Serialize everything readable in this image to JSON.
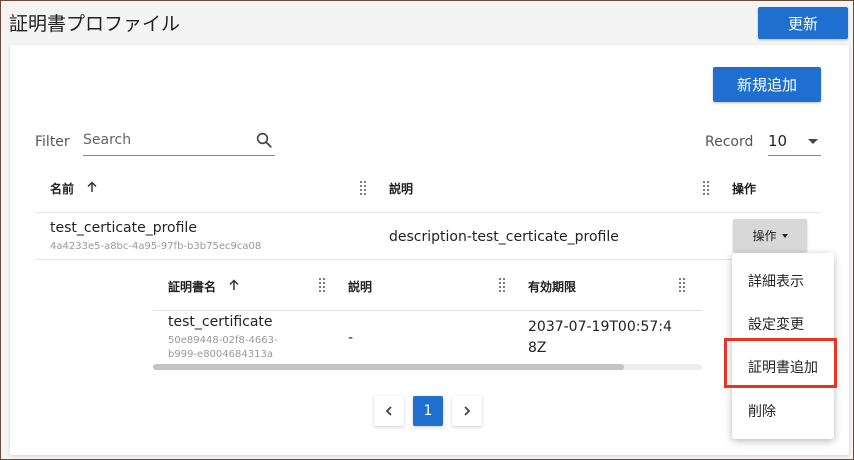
{
  "header": {
    "title": "証明書プロファイル",
    "refresh_label": "更新"
  },
  "toolbar": {
    "add_label": "新規追加",
    "filter_label": "Filter",
    "search_placeholder": "Search",
    "record_label": "Record",
    "record_value": "10"
  },
  "table": {
    "columns": [
      "名前",
      "説明",
      "操作"
    ],
    "rows": [
      {
        "name": "test_certicate_profile",
        "id": "4a4233e5-a8bc-4a95-97fb-b3b75ec9ca08",
        "description": "description-test_certicate_profile",
        "action_label": "操作"
      }
    ]
  },
  "subtable": {
    "columns": [
      "証明書名",
      "説明",
      "有効期限"
    ],
    "rows": [
      {
        "name": "test_certificate",
        "id_line1": "50e89448-02f8-4663-",
        "id_line2": "b999-e8004684313a",
        "description": "-",
        "expiry_line1": "2037-07-19T00:57:4",
        "expiry_line2": "8Z"
      }
    ]
  },
  "pagination": {
    "current": "1"
  },
  "action_menu": {
    "items": [
      "詳細表示",
      "設定変更",
      "証明書追加",
      "削除"
    ]
  },
  "colors": {
    "primary": "#1e6fd0",
    "highlight": "#ea3323"
  }
}
